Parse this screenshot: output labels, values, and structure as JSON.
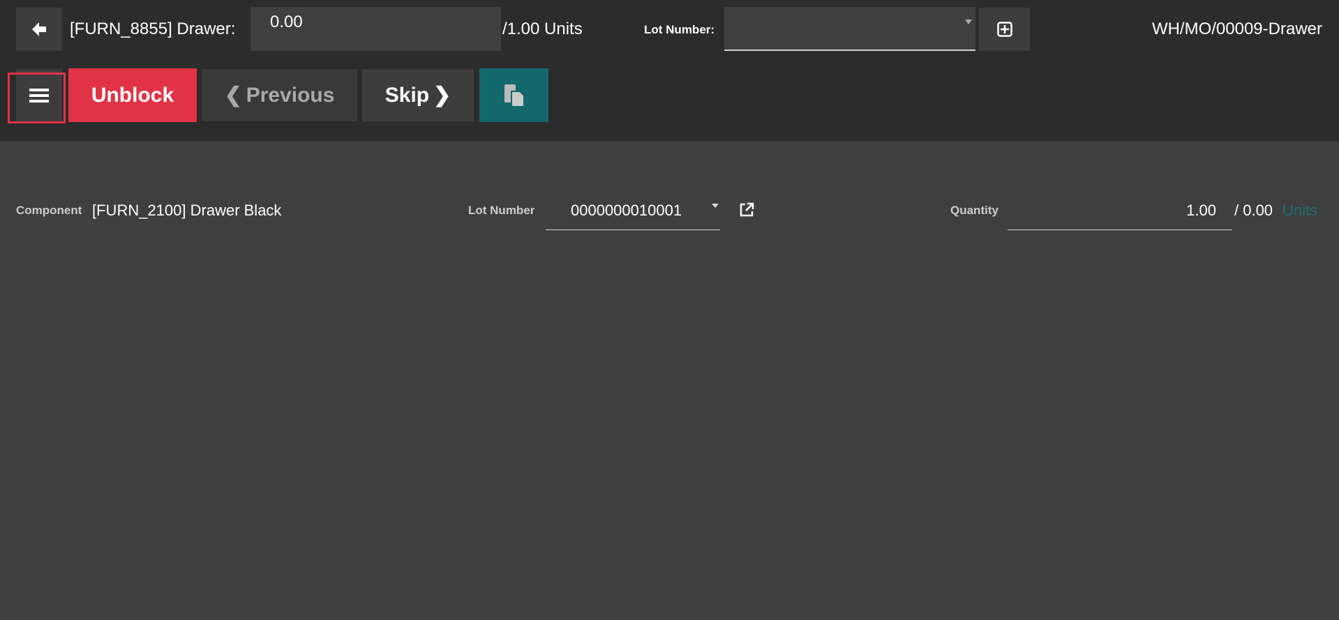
{
  "header": {
    "product_label": "[FURN_8855] Drawer:",
    "qty_value": "0.00",
    "qty_total": "/1.00 Units",
    "lot_label": "Lot Number:",
    "lot_value": "",
    "reference": "WH/MO/00009-Drawer"
  },
  "toolbar": {
    "unblock_label": "Unblock",
    "previous_label": "Previous",
    "skip_label": "Skip"
  },
  "component": {
    "label": "Component",
    "value": "[FURN_2100] Drawer Black",
    "lot_label": "Lot Number",
    "lot_value": "0000000010001",
    "qty_label": "Quantity",
    "qty_value": "1.00",
    "qty_total": "/ 0.00",
    "uom": "Units"
  },
  "colors": {
    "danger": "#e23346",
    "teal": "#13686c",
    "uom": "#1a6e73"
  }
}
